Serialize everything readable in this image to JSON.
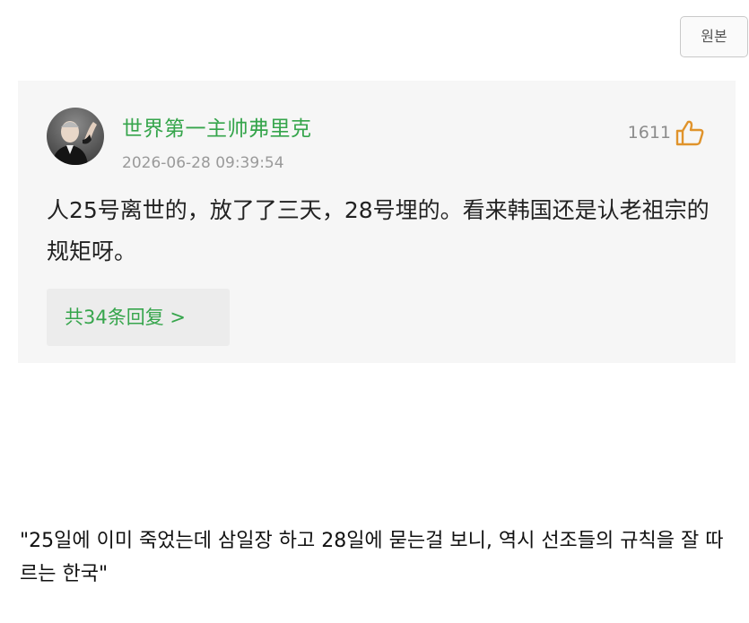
{
  "header": {
    "original_button_label": "원본"
  },
  "comment": {
    "username": "世界第一主帅弗里克",
    "timestamp": "2026-06-28 09:39:54",
    "like_count": "1611",
    "like_icon": "thumbs-up-icon",
    "text": "人25号离世的，放了了三天，28号埋的。看来韩国还是认老祖宗的规矩呀。",
    "replies_label": "共34条回复 >"
  },
  "translation": {
    "text": "\"25일에 이미 죽었는데 삼일장 하고 28일에 묻는걸 보니, 역시 선조들의 규칙을 잘 따르는 한국\""
  },
  "colors": {
    "accent_green": "#36a54c",
    "card_background": "#f6f6f6",
    "like_icon_orange": "#e0932b"
  }
}
